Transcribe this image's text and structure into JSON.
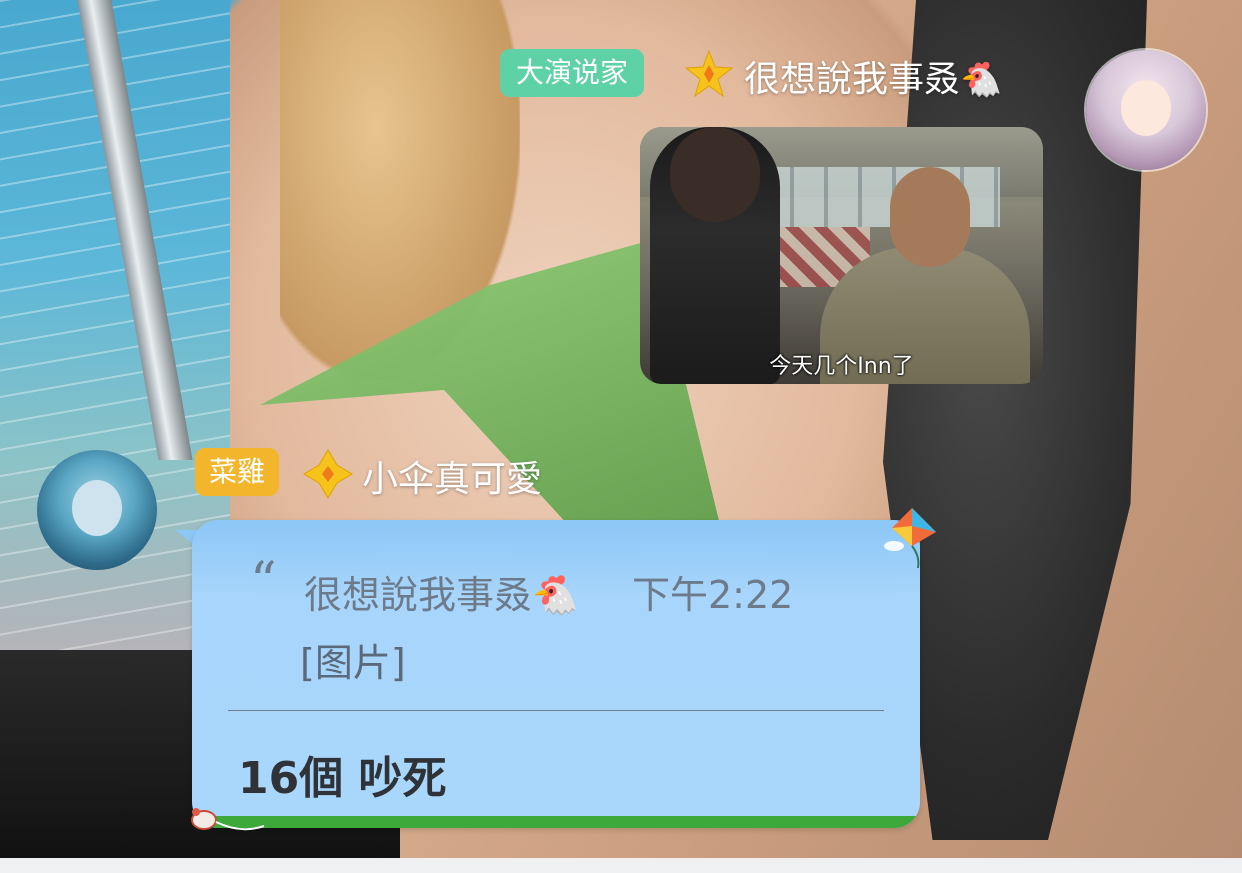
{
  "messages": [
    {
      "side": "right",
      "badge": "大演说家",
      "level_icon": "gold-star-icon",
      "sender_name": "很想說我事叒",
      "sender_emoji": "🐔",
      "avatar_icon": "anime-girl-avatar",
      "image": {
        "caption": "今天几个Inn了"
      }
    },
    {
      "side": "left",
      "badge": "菜雞",
      "level_icon": "gold-diamond-icon",
      "sender_name": "小伞真可愛",
      "avatar_icon": "anime-umbrella-girl-avatar",
      "quote": {
        "mark": "“",
        "author": "很想說我事叒🐔",
        "time": "下午2:22",
        "content": "[图片]"
      },
      "reply_text": "16個 吵死"
    }
  ],
  "colors": {
    "badge_title": "#5ed1a6",
    "badge_rank": "#f2b52b",
    "bubble": "#a9d6fb",
    "grass": "#3ca93a"
  }
}
